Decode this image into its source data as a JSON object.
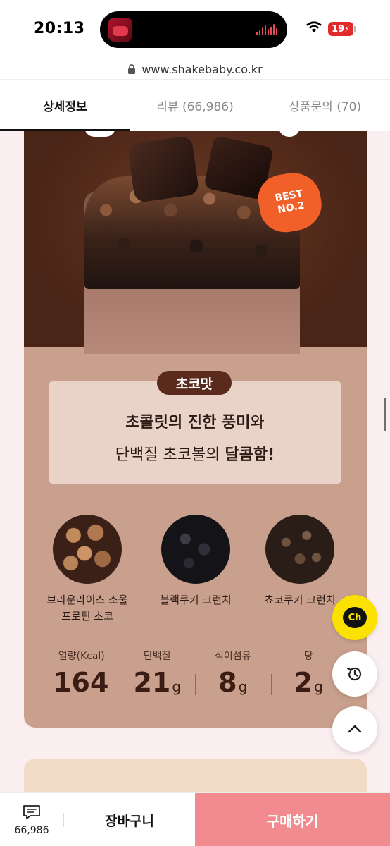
{
  "status_bar": {
    "time": "20:13",
    "battery": "19"
  },
  "browser": {
    "url": "www.shakebaby.co.kr"
  },
  "tabs": [
    {
      "label": "상세정보",
      "active": true
    },
    {
      "label": "리뷰 (66,986)",
      "active": false
    },
    {
      "label": "상품문의 (70)",
      "active": false
    }
  ],
  "product": {
    "badge": {
      "line1": "BEST",
      "line2": "NO.2"
    },
    "flavor": "초코맛",
    "description": {
      "line1_bold": "초콜릿의 진한 풍미",
      "line1_rest": "와",
      "line2_prefix": "단백질 초코볼의 ",
      "line2_bold": "달콤함!"
    },
    "toppings": [
      {
        "line1": "브라운라이스 소울",
        "line2": "프로틴 초코"
      },
      {
        "line1": "블랙쿠키 크런치",
        "line2": ""
      },
      {
        "line1": "쵸코쿠키 크런치",
        "line2": ""
      }
    ],
    "nutrition": [
      {
        "label": "열량(Kcal)",
        "value": "164",
        "unit": ""
      },
      {
        "label": "단백질",
        "value": "21",
        "unit": "g"
      },
      {
        "label": "식이섬유",
        "value": "8",
        "unit": "g"
      },
      {
        "label": "당",
        "value": "2",
        "unit": "g"
      }
    ]
  },
  "floating": {
    "channel_label": "Ch"
  },
  "bottom_bar": {
    "review_count": "66,986",
    "cart_label": "장바구니",
    "buy_label": "구매하기"
  },
  "colors": {
    "buy": "#f28b8f",
    "channel": "#fae100",
    "card": "#c9a08d",
    "best_badge": "#f2602a"
  },
  "icons": [
    "lock-icon",
    "wifi-icon",
    "battery-icon",
    "chat-icon",
    "channel-icon",
    "history-icon",
    "chevron-up-icon"
  ]
}
